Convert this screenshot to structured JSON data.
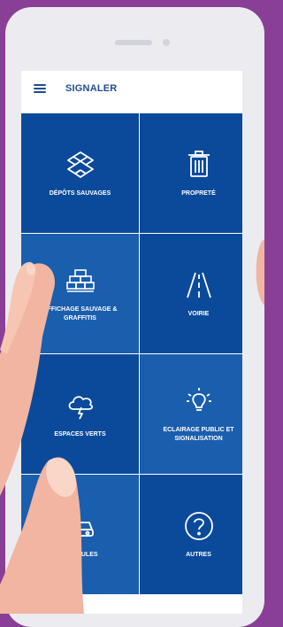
{
  "header": {
    "title": "SIGNALER",
    "menu_icon": "hamburger-icon"
  },
  "tiles": [
    {
      "label": "DÉPÔTS SAUVAGES",
      "icon": "boxes-icon"
    },
    {
      "label": "PROPRETÉ",
      "icon": "trash-icon"
    },
    {
      "label": "AFFICHAGE SAUVAGE & GRAFFITIS",
      "icon": "bricks-icon"
    },
    {
      "label": "VOIRIE",
      "icon": "road-icon"
    },
    {
      "label": "ESPACES VERTS",
      "icon": "storm-icon"
    },
    {
      "label": "ECLAIRAGE PUBLIC ET SIGNALISATION",
      "icon": "bulb-icon"
    },
    {
      "label": "VÉHICULES",
      "icon": "car-icon"
    },
    {
      "label": "AUTRES",
      "icon": "question-icon"
    }
  ],
  "colors": {
    "background": "#8a3f96",
    "tile_dark": "#0b4a9b",
    "tile_light": "#1a5eae",
    "accent": "#1f4d90"
  }
}
